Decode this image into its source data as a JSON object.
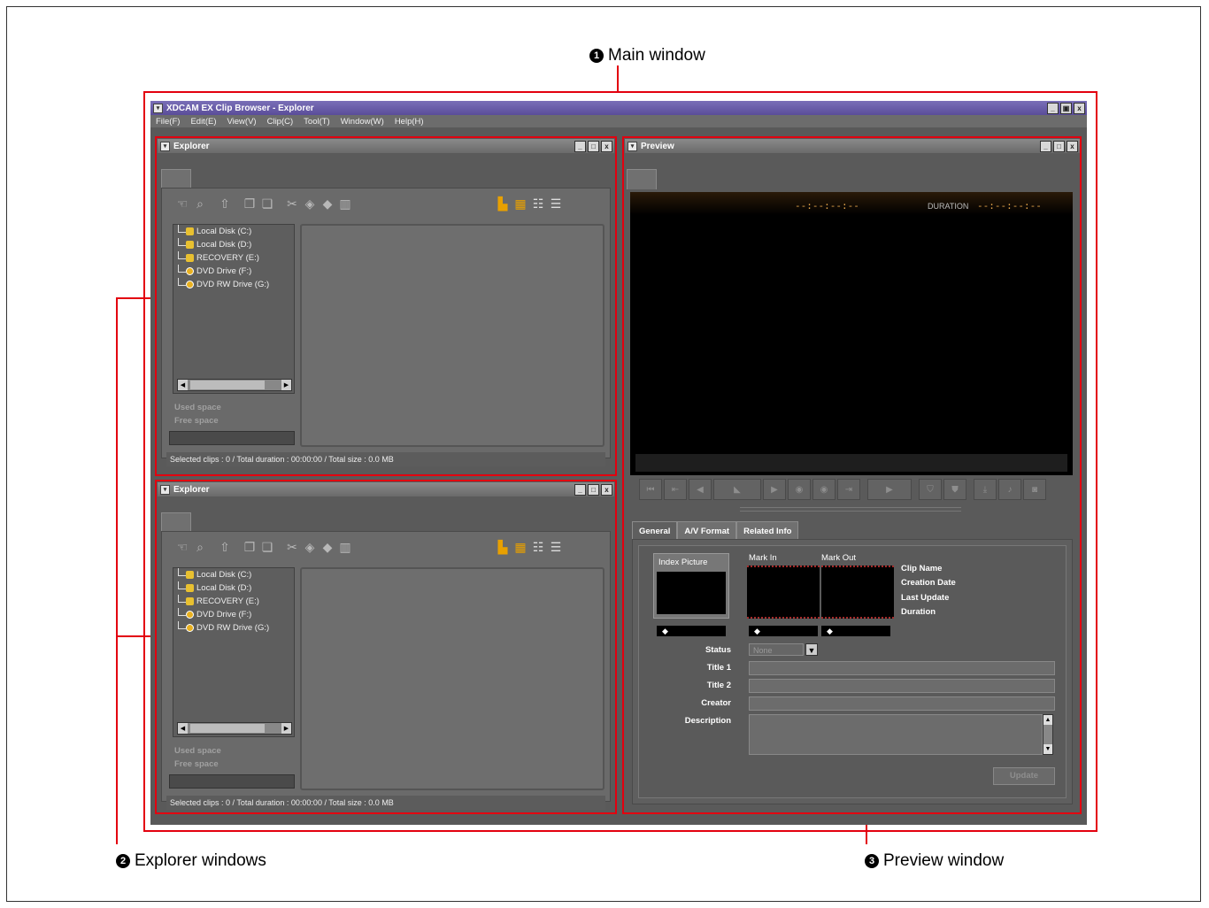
{
  "callouts": {
    "main": {
      "num": "1",
      "label": "Main window"
    },
    "explorer": {
      "num": "2",
      "label": "Explorer windows"
    },
    "preview": {
      "num": "3",
      "label": "Preview window"
    }
  },
  "app": {
    "title": "XDCAM EX Clip Browser - Explorer",
    "menu": [
      "File(F)",
      "Edit(E)",
      "View(V)",
      "Clip(C)",
      "Tool(T)",
      "Window(W)",
      "Help(H)"
    ],
    "window_buttons": [
      "_",
      "▣",
      "x"
    ]
  },
  "explorers": [
    {
      "title": "Explorer",
      "tree": [
        "Local Disk (C:)",
        "Local Disk (D:)",
        "RECOVERY (E:)",
        "DVD Drive (F:)",
        "DVD RW Drive (G:)"
      ],
      "used_space": "Used space",
      "free_space": "Free space",
      "status": "Selected clips : 0 / Total duration : 00:00:00 / Total size : 0.0 MB"
    },
    {
      "title": "Explorer",
      "tree": [
        "Local Disk (C:)",
        "Local Disk (D:)",
        "RECOVERY (E:)",
        "DVD Drive (F:)",
        "DVD RW Drive (G:)"
      ],
      "used_space": "Used space",
      "free_space": "Free space",
      "status": "Selected clips : 0 / Total duration : 00:00:00 / Total size : 0.0 MB"
    }
  ],
  "toolbar_icons": [
    "hand-icon",
    "find-icon",
    "up-folder-icon",
    "copy-icon",
    "paste-icon",
    "cut-icon",
    "eraser-icon",
    "eraser2-icon",
    "trash-icon",
    "tree-view-icon",
    "thumbnail-view-icon",
    "detail-view-icon",
    "list-view-icon"
  ],
  "preview": {
    "title": "Preview",
    "timecode": "--:--:--:--",
    "duration_label": "DURATION",
    "duration_value": "--:--:--:--",
    "tabs": [
      "General",
      "A/V Format",
      "Related Info"
    ],
    "index_picture": "Index Picture",
    "mark_in": "Mark In",
    "mark_out": "Mark Out",
    "info_labels": [
      "Clip Name",
      "Creation Date",
      "Last Update",
      "Duration"
    ],
    "status_label": "Status",
    "status_value": "None",
    "title1_label": "Title 1",
    "title2_label": "Title 2",
    "creator_label": "Creator",
    "description_label": "Description",
    "update_button": "Update",
    "marker": "◆"
  },
  "colors": {
    "callout_red": "#e3000f",
    "titlebar": "#5a4d99",
    "timecode": "#e2a34a"
  }
}
